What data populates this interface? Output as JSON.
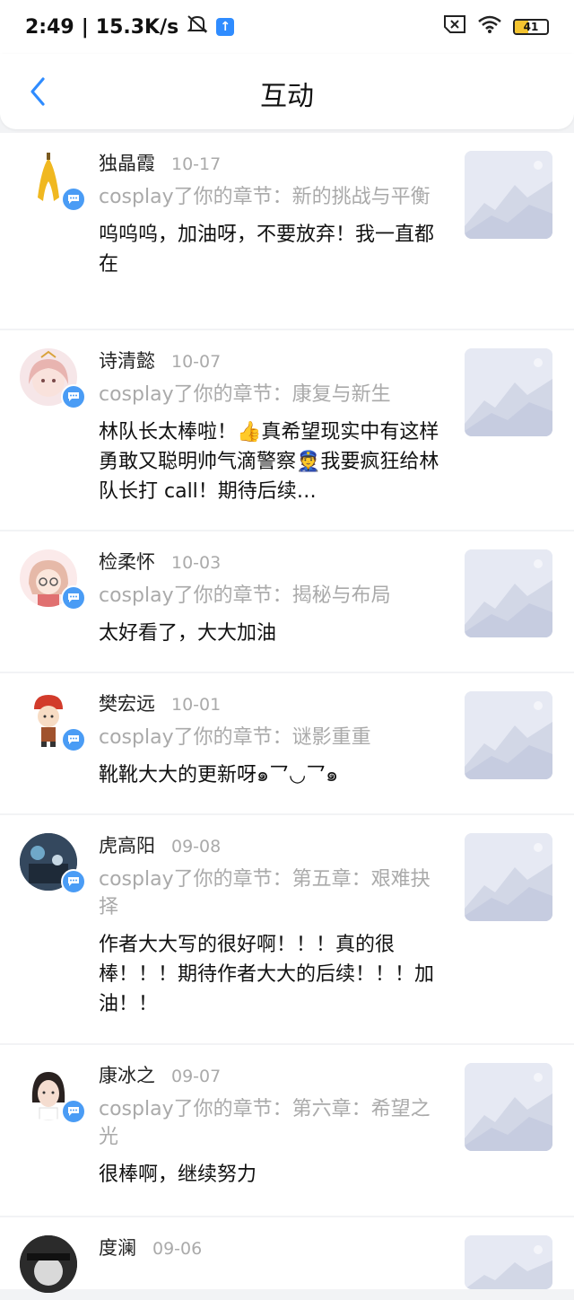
{
  "status_bar": {
    "time": "2:49",
    "net_speed": "15.3K/s",
    "battery": "41"
  },
  "header": {
    "title": "互动"
  },
  "items": [
    {
      "name": "独晶霞",
      "date": "10-17",
      "chapter": "cosplay了你的章节：新的挑战与平衡",
      "comment": "呜呜呜，加油呀，不要放弃！我一直都在"
    },
    {
      "name": "诗清懿",
      "date": "10-07",
      "chapter": "cosplay了你的章节：康复与新生",
      "comment": "林队长太棒啦！👍真希望现实中有这样勇敢又聪明帅气滴警察👮我要疯狂给林队长打 call！期待后续…"
    },
    {
      "name": "检柔怀",
      "date": "10-03",
      "chapter": "cosplay了你的章节：揭秘与布局",
      "comment": "太好看了，大大加油"
    },
    {
      "name": "樊宏远",
      "date": "10-01",
      "chapter": "cosplay了你的章节：谜影重重",
      "comment": "靴靴大大的更新呀๑乛◡乛๑"
    },
    {
      "name": "虎高阳",
      "date": "09-08",
      "chapter": "cosplay了你的章节：第五章：艰难抉择",
      "comment": "作者大大写的很好啊！！！真的很棒！！！期待作者大大的后续！！！加油！！"
    },
    {
      "name": "康冰之",
      "date": "09-07",
      "chapter": "cosplay了你的章节：第六章：希望之光",
      "comment": "很棒啊，继续努力"
    },
    {
      "name": "度澜",
      "date": "09-06",
      "chapter": "",
      "comment": ""
    }
  ]
}
